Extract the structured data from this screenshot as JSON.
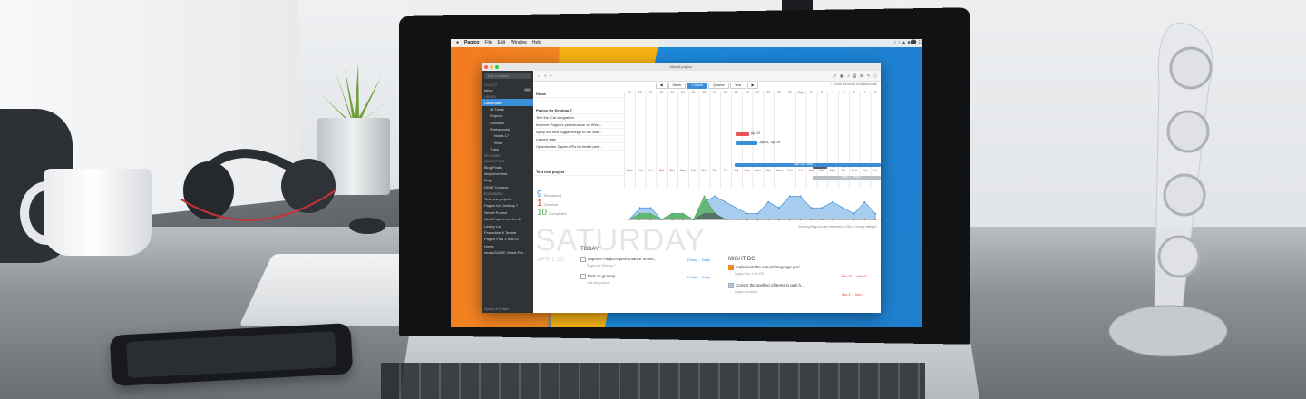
{
  "menubar": {
    "items": [
      "Pagico",
      "File",
      "Edit",
      "Window",
      "Help"
    ]
  },
  "window": {
    "title": "Myself.pagico"
  },
  "sidebar": {
    "search_placeholder": "Type to search",
    "sections": [
      {
        "heading": "COLLECT",
        "items": [
          {
            "label": "Inbox",
            "badge": "102"
          }
        ]
      },
      {
        "heading": "LIBRARY",
        "items": [
          {
            "label": "Dashboard",
            "selected": true
          },
          {
            "label": "All Tasks",
            "indent": true
          },
          {
            "label": "Projects"
          },
          {
            "label": "Contacts"
          },
          {
            "label": "Workspaces"
          },
          {
            "label": "Notes 17",
            "indent": true
          },
          {
            "label": "Work",
            "indent": true
          },
          {
            "label": "Trash"
          }
        ]
      },
      {
        "heading": "UPCOMING",
        "items": []
      },
      {
        "heading": "COLLECTIONS",
        "items": [
          {
            "label": "Blog Posts"
          },
          {
            "label": "dimprovement"
          },
          {
            "label": "Bugs"
          },
          {
            "label": "DRAT Courses"
          }
        ]
      },
      {
        "heading": "BOOKMARKS",
        "items": [
          {
            "label": "Test new project"
          },
          {
            "label": "Pagico for Desktop 7"
          },
          {
            "label": "Secret Project"
          },
          {
            "label": "New Project, version 2"
          },
          {
            "label": "Lesley Liu"
          },
          {
            "label": "Promotion & Tenure"
          },
          {
            "label": "Pagico Plus 3 for iOS"
          },
          {
            "label": "Home"
          },
          {
            "label": "musicGUIDE: Music For..."
          }
        ]
      }
    ],
    "footer": "Synced at 9:00pm"
  },
  "toolbar": {
    "views": [
      "Week",
      "1 Week",
      "Quarter",
      "Year"
    ],
    "active_view": "1 Week",
    "show_previous": "Show previously completed tasks"
  },
  "gantt": {
    "rows": [
      {
        "label": "Home",
        "head": true
      },
      {
        "label": "Pagico for Desktop 7",
        "head": true
      },
      {
        "label": "Test the iCal integration"
      },
      {
        "label": "Improve Pagico's performance on Wind..."
      },
      {
        "label": "Apply the new toggle design to the data..."
      },
      {
        "label": "Launch date"
      },
      {
        "label": "Optimize the Zapier APIs for better perf..."
      },
      {
        "label": "Test new project",
        "head": true
      }
    ],
    "day_numbers": [
      "15",
      "16",
      "17",
      "18",
      "19",
      "20",
      "21",
      "22",
      "23",
      "24",
      "25",
      "26",
      "27",
      "28",
      "29",
      "30",
      "May",
      "2",
      "3",
      "4",
      "5",
      "6",
      "7",
      "8"
    ],
    "weekdays": [
      "Wed",
      "Thu",
      "Fri",
      "Sat",
      "Sun",
      "Mon",
      "Tue",
      "Wed",
      "Thu",
      "Fri",
      "Sat",
      "Sun",
      "Mon",
      "Tue",
      "Wed",
      "Thu",
      "Fri",
      "Sat",
      "Sun",
      "Mon",
      "Tue",
      "Wed",
      "Thu",
      "Fri"
    ],
    "bars": [
      {
        "label": "Apr 24",
        "start": 10.5,
        "end": 11.7,
        "color": "#e9545b"
      },
      {
        "label": "Apr 24 - Apr 25",
        "start": 10.5,
        "end": 12.5,
        "color": "#3b8fd9"
      },
      {
        "label": "May 1 - May 2",
        "start": 17.6,
        "end": 19.0,
        "color": "#555b61"
      },
      {
        "label": "Apr 24 - May 1",
        "start": 10.3,
        "end": 24,
        "color": "#3b8fd9"
      },
      {
        "label": "May 1 - May 5",
        "start": 17.6,
        "end": 24,
        "color": "#b9bec3"
      }
    ]
  },
  "stats": [
    {
      "number": "9",
      "label": "Remaining",
      "color": "#3b8fd9"
    },
    {
      "number": "1",
      "label": "Overdue",
      "color": "#d9362e"
    },
    {
      "number": "10",
      "label": "Completed",
      "color": "#4caf50"
    }
  ],
  "chart_data": {
    "type": "area",
    "x": [
      "Wed",
      "Thu",
      "Fri",
      "Sat",
      "Sun",
      "Mon",
      "Tue",
      "Wed",
      "Thu",
      "Fri",
      "Sat",
      "Sun",
      "Mon",
      "Tue",
      "Wed",
      "Thu",
      "Fri",
      "Sat",
      "Sun",
      "Mon",
      "Tue",
      "Wed",
      "Thu",
      "Fri"
    ],
    "series": [
      {
        "values": [
          0,
          2,
          2,
          0,
          1,
          1,
          0,
          3,
          4,
          3,
          2,
          1,
          1,
          3,
          2,
          4,
          4,
          2,
          2,
          3,
          2,
          1,
          3,
          1
        ],
        "color": "#3b8fd9"
      },
      {
        "values": [
          0,
          1,
          1,
          0,
          1,
          1,
          0,
          4,
          1,
          0,
          0,
          0,
          0,
          0,
          0,
          0,
          0,
          0,
          0,
          0,
          0,
          0,
          0,
          0
        ],
        "color": "#4caf50"
      },
      {
        "values": [
          0,
          0,
          0,
          0,
          0,
          0,
          0,
          1,
          1,
          0,
          0,
          0,
          0,
          0,
          0,
          0,
          0,
          0,
          0,
          0,
          0,
          0,
          0,
          0
        ],
        "color": "#555b61"
      }
    ],
    "ylim": [
      0,
      5
    ]
  },
  "showing_note": "Showing things you are interested in ONLY. Change settings?",
  "dashboard": {
    "big_day": "SATURDAY",
    "big_date": "APRIL 25",
    "today_heading": "TODAY",
    "might_heading": "MIGHT DO",
    "today_tasks": [
      {
        "title": "Improve Pagico's performance on Wi...",
        "project": "Pagico for Desktop 7",
        "when": "Friday → Today"
      },
      {
        "title": "Pick up grocery",
        "project": "Test new project",
        "when": "Friday → Today"
      }
    ],
    "might_tasks": [
      {
        "title": "Implement the natural language proc...",
        "project": "Pagico Plus 3 for iOS",
        "when": "Mar 20 → Mar 24"
      },
      {
        "title": "Correct the spelling of items in task h...",
        "project": "Pagico version 6",
        "when": "Nov 3 → Nov 4"
      }
    ]
  }
}
